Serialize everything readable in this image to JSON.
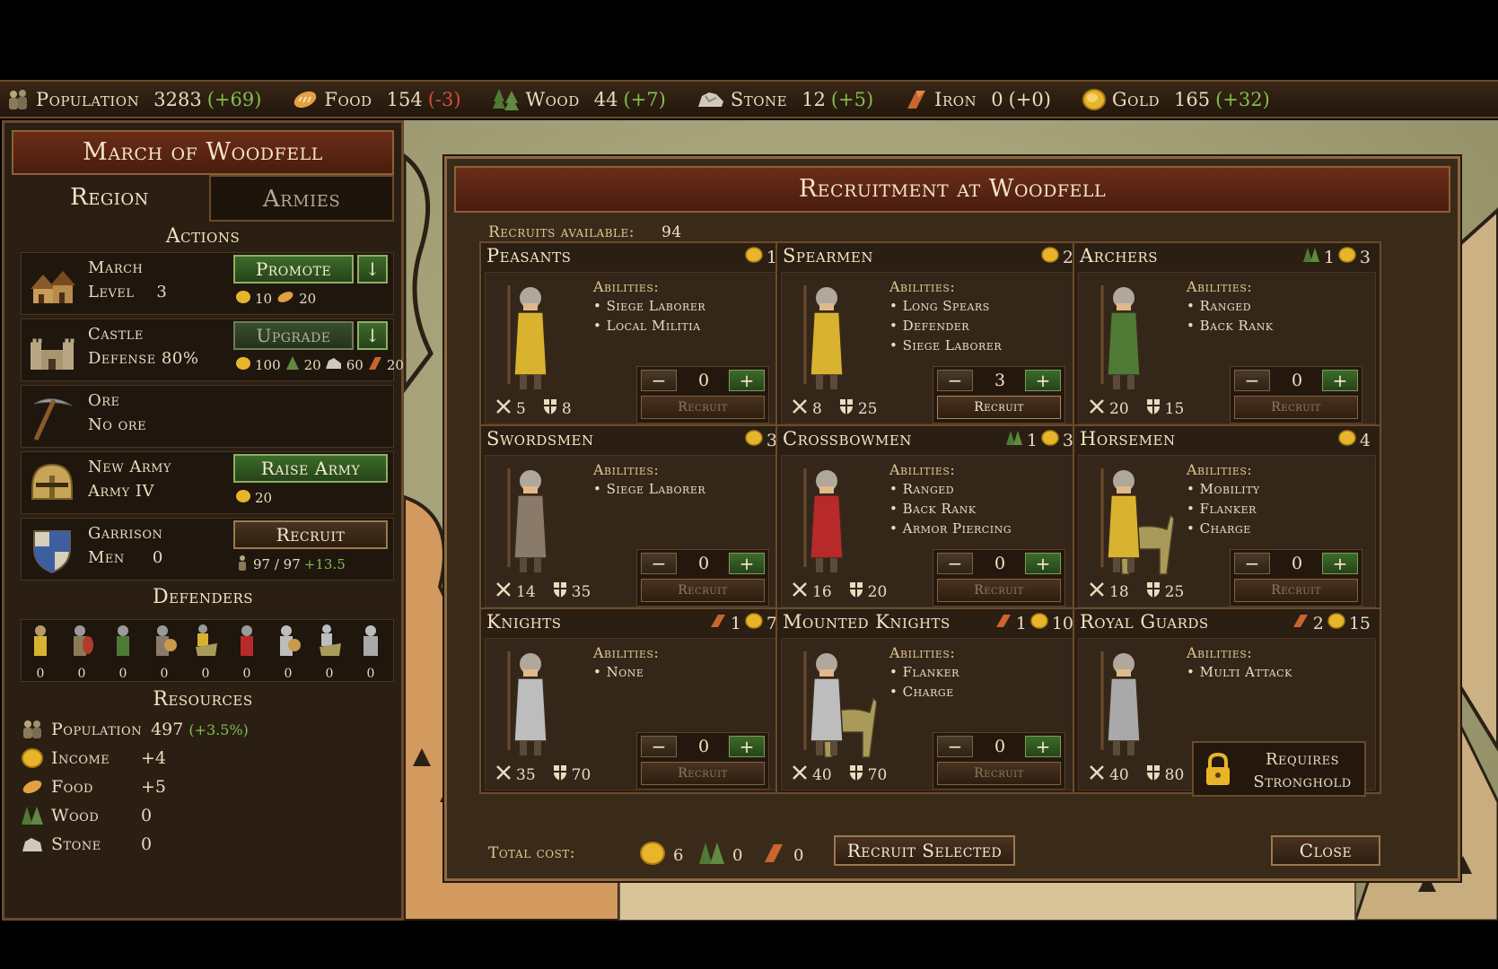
{
  "topbar": {
    "population": {
      "label": "Population",
      "value": "3283",
      "delta": "(+69)"
    },
    "food": {
      "label": "Food",
      "value": "154",
      "delta": "(-3)"
    },
    "wood": {
      "label": "Wood",
      "value": "44",
      "delta": "(+7)"
    },
    "stone": {
      "label": "Stone",
      "value": "12",
      "delta": "(+5)"
    },
    "iron": {
      "label": "Iron",
      "value": "0",
      "delta": "(+0)"
    },
    "gold": {
      "label": "Gold",
      "value": "165",
      "delta": "(+32)"
    }
  },
  "colors": {
    "gold": "#e8b42a",
    "positive": "#7fbf4f",
    "negative": "#d0503a",
    "button_green": "#3d6b2a",
    "title_red": "#6b2d18"
  },
  "region": {
    "title": "March of Woodfell",
    "tabs": [
      "Region",
      "Armies"
    ],
    "actions_heading": "Actions",
    "march": {
      "line1": "March",
      "line2_label": "Level",
      "level": "3",
      "button": "Promote",
      "arrow": "↓",
      "cost_gold": "10",
      "cost_food": "20"
    },
    "castle": {
      "line1": "Castle",
      "line2": "Defense 80%",
      "button": "Upgrade",
      "arrow": "↓",
      "cost_gold": "100",
      "cost_wood": "20",
      "cost_stone": "60",
      "cost_iron": "20"
    },
    "ore": {
      "line1": "Ore",
      "line2": "No ore"
    },
    "new_army": {
      "line1": "New Army",
      "line2": "Army IV",
      "button": "Raise Army",
      "cost_gold": "20"
    },
    "garrison": {
      "line1": "Garrison",
      "line2_label": "Men",
      "men": "0",
      "button": "Recruit",
      "capacity": "97 / 97",
      "rate": "+13.5"
    },
    "defenders_heading": "Defenders",
    "defenders": [
      "0",
      "0",
      "0",
      "0",
      "0",
      "0",
      "0",
      "0",
      "0"
    ],
    "resources_heading": "Resources",
    "resources": {
      "population": {
        "label": "Population",
        "value": "497",
        "delta": "(+3.5%)"
      },
      "income": {
        "label": "Income",
        "value": "+4"
      },
      "food": {
        "label": "Food",
        "value": "+5"
      },
      "wood": {
        "label": "Wood",
        "value": "0"
      },
      "stone": {
        "label": "Stone",
        "value": "0"
      }
    }
  },
  "recruitment": {
    "title": "Recruitment at Woodfell",
    "recruits_label": "Recruits available:",
    "recruits_value": "94",
    "abilities_label": "Abilities:",
    "recruit_label": "Recruit",
    "units": [
      {
        "name": "Peasants",
        "wood": "",
        "iron": "",
        "gold": "1",
        "abilities": [
          "• Siege Laborer",
          "• Local Militia"
        ],
        "attack": "5",
        "defense": "8",
        "qty": "0",
        "active": false
      },
      {
        "name": "Spearmen",
        "wood": "",
        "iron": "",
        "gold": "2",
        "abilities": [
          "• Long Spears",
          "• Defender",
          "• Siege Laborer"
        ],
        "attack": "8",
        "defense": "25",
        "qty": "3",
        "active": true
      },
      {
        "name": "Archers",
        "wood": "1",
        "iron": "",
        "gold": "3",
        "abilities": [
          "• Ranged",
          "• Back Rank"
        ],
        "attack": "20",
        "defense": "15",
        "qty": "0",
        "active": false
      },
      {
        "name": "Swordsmen",
        "wood": "",
        "iron": "",
        "gold": "3",
        "abilities": [
          "• Siege Laborer"
        ],
        "attack": "14",
        "defense": "35",
        "qty": "0",
        "active": false
      },
      {
        "name": "Crossbowmen",
        "wood": "1",
        "iron": "",
        "gold": "3",
        "abilities": [
          "• Ranged",
          "• Back Rank",
          "• Armor Piercing"
        ],
        "attack": "16",
        "defense": "20",
        "qty": "0",
        "active": false
      },
      {
        "name": "Horsemen",
        "wood": "",
        "iron": "",
        "gold": "4",
        "abilities": [
          "• Mobility",
          "• Flanker",
          "• Charge"
        ],
        "attack": "18",
        "defense": "25",
        "qty": "0",
        "active": false
      },
      {
        "name": "Knights",
        "wood": "",
        "iron": "1",
        "gold": "7",
        "abilities": [
          "• None"
        ],
        "attack": "35",
        "defense": "70",
        "qty": "0",
        "active": false
      },
      {
        "name": "Mounted Knights",
        "wood": "",
        "iron": "1",
        "gold": "10",
        "abilities": [
          "• Flanker",
          "• Charge"
        ],
        "attack": "40",
        "defense": "70",
        "qty": "0",
        "active": false
      },
      {
        "name": "Royal Guards",
        "wood": "",
        "iron": "2",
        "gold": "15",
        "abilities": [
          "• Multi Attack"
        ],
        "attack": "40",
        "defense": "80",
        "locked": true
      }
    ],
    "requires": "Requires",
    "stronghold": "Stronghold",
    "total_label": "Total cost:",
    "total_gold": "6",
    "total_wood": "0",
    "total_iron": "0",
    "recruit_selected": "Recruit Selected",
    "close": "Close"
  }
}
